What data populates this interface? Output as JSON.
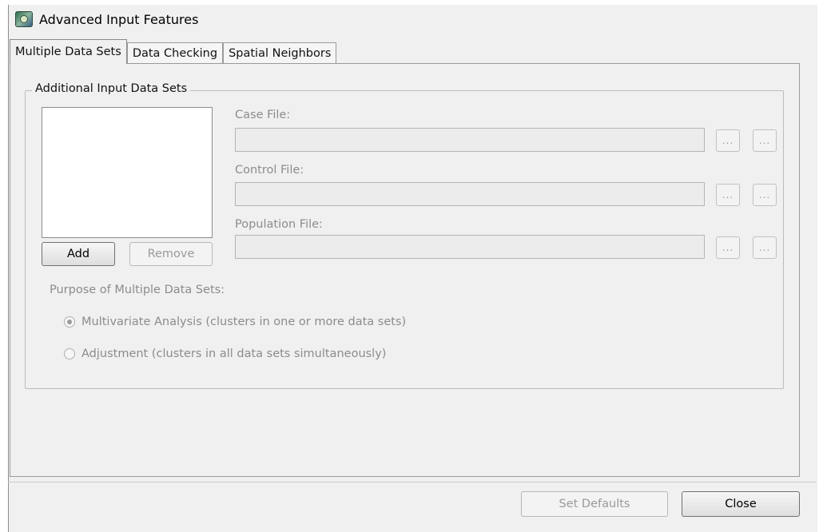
{
  "window": {
    "title": "Advanced Input Features",
    "icon": "satscan-app-icon"
  },
  "tabs": [
    {
      "label": "Multiple Data Sets",
      "active": true
    },
    {
      "label": "Data Checking",
      "active": false
    },
    {
      "label": "Spatial Neighbors",
      "active": false
    }
  ],
  "group": {
    "legend": "Additional Input Data Sets",
    "add_label": "Add",
    "remove_label": "Remove"
  },
  "fields": {
    "case": {
      "label": "Case File:",
      "value": "",
      "browse_label": "...",
      "import_label": "..."
    },
    "control": {
      "label": "Control File:",
      "value": "",
      "browse_label": "...",
      "import_label": "..."
    },
    "population": {
      "label": "Population File:",
      "value": "",
      "browse_label": "...",
      "import_label": "..."
    }
  },
  "purpose": {
    "label": "Purpose of Multiple Data Sets:",
    "options": [
      {
        "label": "Multivariate Analysis (clusters in one or more data sets)",
        "checked": true
      },
      {
        "label": "Adjustment (clusters in all data sets simultaneously)",
        "checked": false
      }
    ]
  },
  "footer": {
    "set_defaults_label": "Set Defaults",
    "close_label": "Close"
  }
}
